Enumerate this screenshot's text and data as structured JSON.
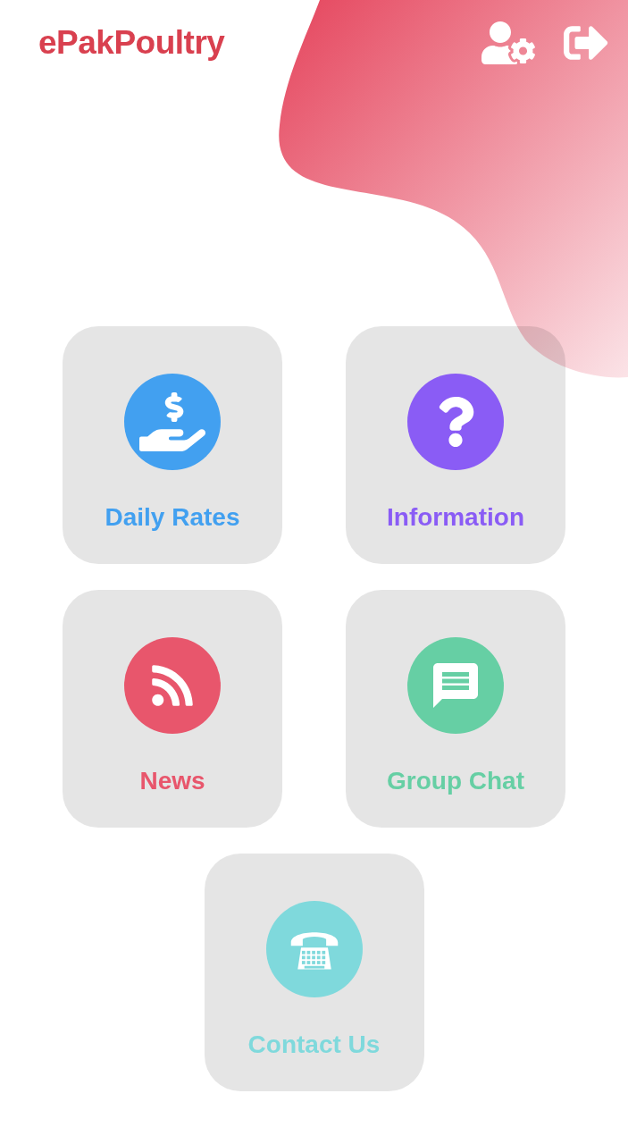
{
  "app_title": "ePakPoultry",
  "tiles": [
    {
      "kind": "rates",
      "label": "Daily Rates",
      "color": "#42a0f0"
    },
    {
      "kind": "info",
      "label": "Information",
      "color": "#8a5cf5"
    },
    {
      "kind": "news",
      "label": "News",
      "color": "#e8566c"
    },
    {
      "kind": "chat",
      "label": "Group Chat",
      "color": "#66cfa4"
    },
    {
      "kind": "contact",
      "label": "Contact Us",
      "color": "#7fd9dc"
    }
  ]
}
